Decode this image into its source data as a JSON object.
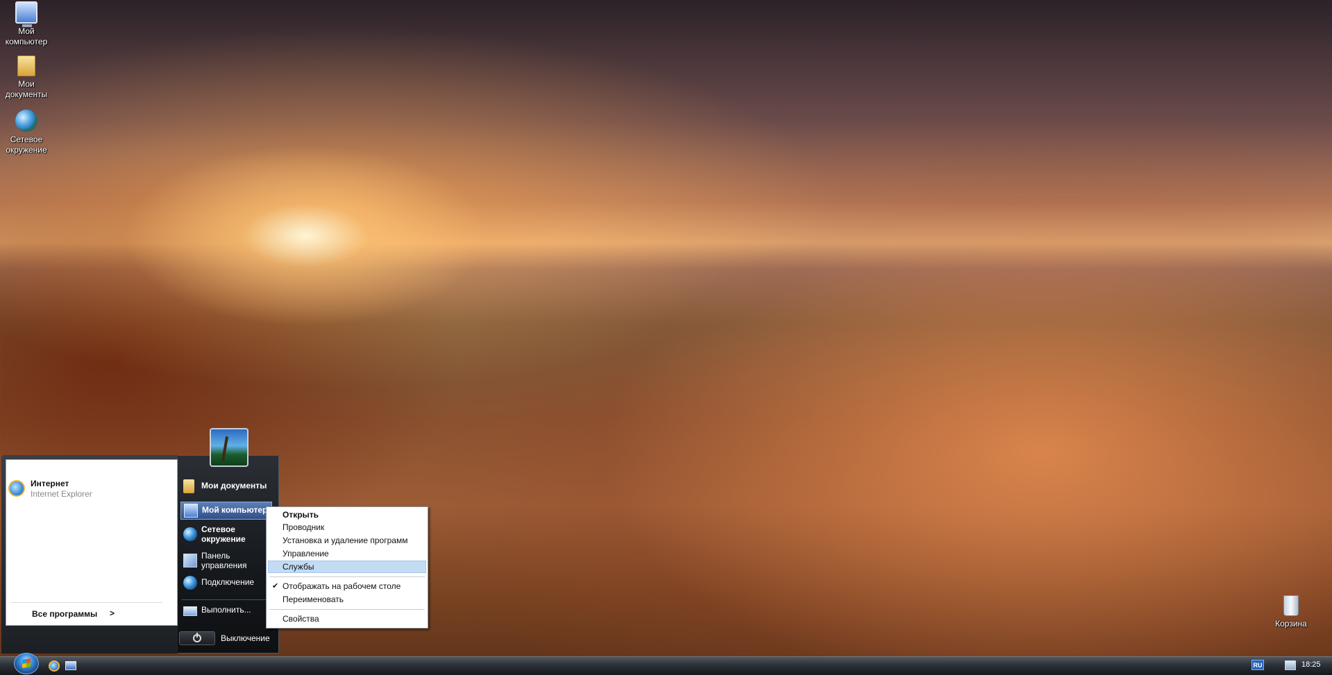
{
  "desktop": {
    "icons": [
      {
        "label": "Мой компьютер",
        "icon": "computer-icon"
      },
      {
        "label": "Мои документы",
        "icon": "folder-icon"
      },
      {
        "label": "Сетевое окружение",
        "icon": "network-globe-icon"
      },
      {
        "label": "Корзина",
        "icon": "recycle-bin-icon"
      }
    ]
  },
  "start_menu": {
    "pinned": {
      "title": "Интернет",
      "subtitle": "Internet Explorer",
      "icon": "internet-explorer-icon"
    },
    "all_programs": "Все программы",
    "all_programs_arrow": ">",
    "right_items": [
      {
        "label": "Мои документы",
        "icon": "documents-folder-icon"
      },
      {
        "label": "Мой компьютер",
        "icon": "computer-icon"
      },
      {
        "label": "Сетевое окружение",
        "icon": "network-globe-icon"
      },
      {
        "label": "Панель управления",
        "icon": "control-panel-icon"
      },
      {
        "label": "Подключение",
        "icon": "connection-globe-icon"
      },
      {
        "label": "Выполнить...",
        "icon": "run-icon"
      }
    ],
    "shutdown_label": "Выключение"
  },
  "context_menu": {
    "items": [
      {
        "label": "Открыть"
      },
      {
        "label": "Проводник"
      },
      {
        "label": "Установка и удаление программ"
      },
      {
        "label": "Управление"
      },
      {
        "label": "Службы"
      },
      {
        "label": "Отображать на рабочем столе"
      },
      {
        "label": "Переименовать"
      },
      {
        "label": "Свойства"
      }
    ],
    "check_mark": "✔"
  },
  "taskbar": {
    "language": "RU",
    "clock": "18:25"
  }
}
